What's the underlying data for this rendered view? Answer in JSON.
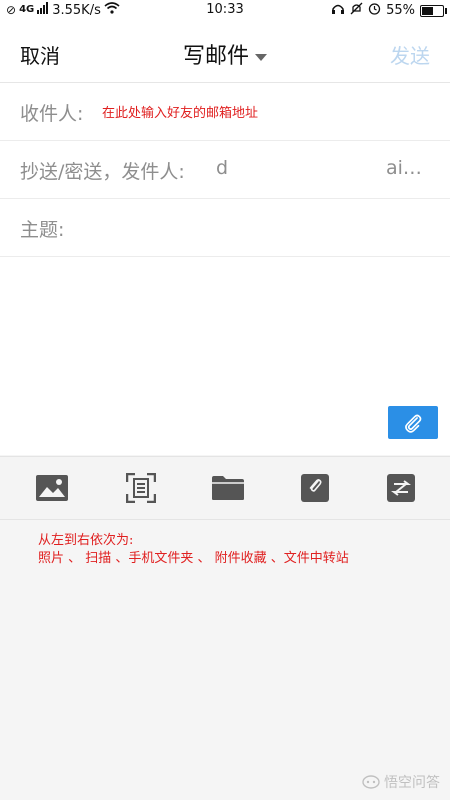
{
  "status_bar": {
    "network_label": "4G",
    "speed": "3.55K/s",
    "time": "10:33",
    "battery_percent": "55%",
    "battery_level": 0.55
  },
  "header": {
    "cancel_label": "取消",
    "title": "写邮件",
    "send_label": "发送"
  },
  "form": {
    "to_label": "收件人:",
    "to_annotation": "在此处输入好友的邮箱地址",
    "cc_label": "抄送/密送，发件人:",
    "cc_value_1": "d",
    "cc_value_2": "ai…",
    "subject_label": "主题:"
  },
  "toolbar": {
    "items": [
      {
        "name": "photo-icon"
      },
      {
        "name": "scan-icon"
      },
      {
        "name": "folder-icon"
      },
      {
        "name": "favorite-attachment-icon"
      },
      {
        "name": "transfer-icon"
      }
    ]
  },
  "annotation": {
    "line1": "从左到右依次为:",
    "line2": "照片 、 扫描 、手机文件夹 、 附件收藏 、文件中转站"
  },
  "watermark": {
    "text": "悟空问答"
  }
}
